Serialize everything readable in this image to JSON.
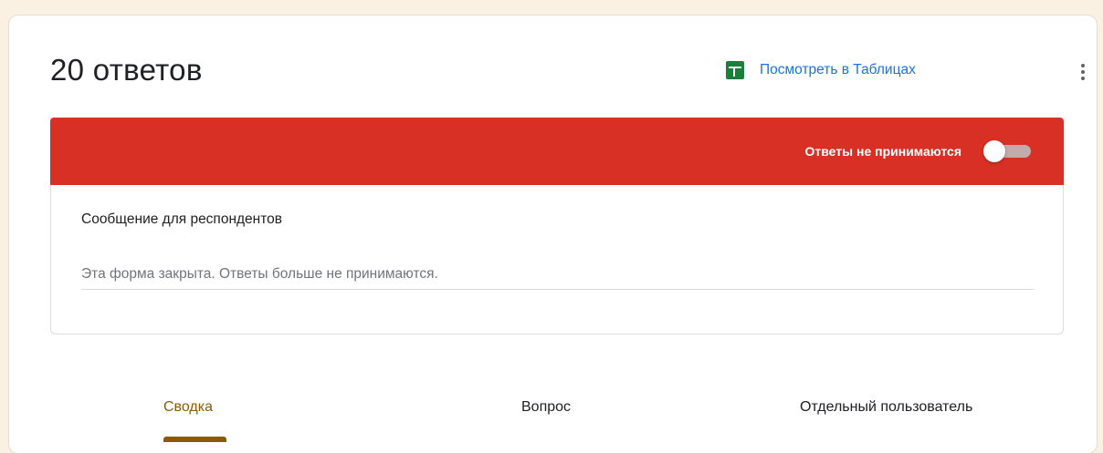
{
  "header": {
    "title": "20 ответов",
    "sheets_link": "Посмотреть в Таблицах"
  },
  "accepting": {
    "label": "Ответы не принимаются",
    "toggle_on": false
  },
  "message": {
    "title": "Сообщение для респондентов",
    "value": "Эта форма закрыта. Ответы больше не принимаются."
  },
  "tabs": [
    {
      "label": "Сводка",
      "active": true
    },
    {
      "label": "Вопрос",
      "active": false
    },
    {
      "label": "Отдельный пользователь",
      "active": false
    }
  ],
  "icons": {
    "sheets": "google-sheets-icon",
    "more": "more-vert-icon"
  },
  "colors": {
    "accent": "#d93025",
    "link": "#1a73e8",
    "sheets_green": "#188038",
    "active_tab": "#8a5a0b"
  }
}
